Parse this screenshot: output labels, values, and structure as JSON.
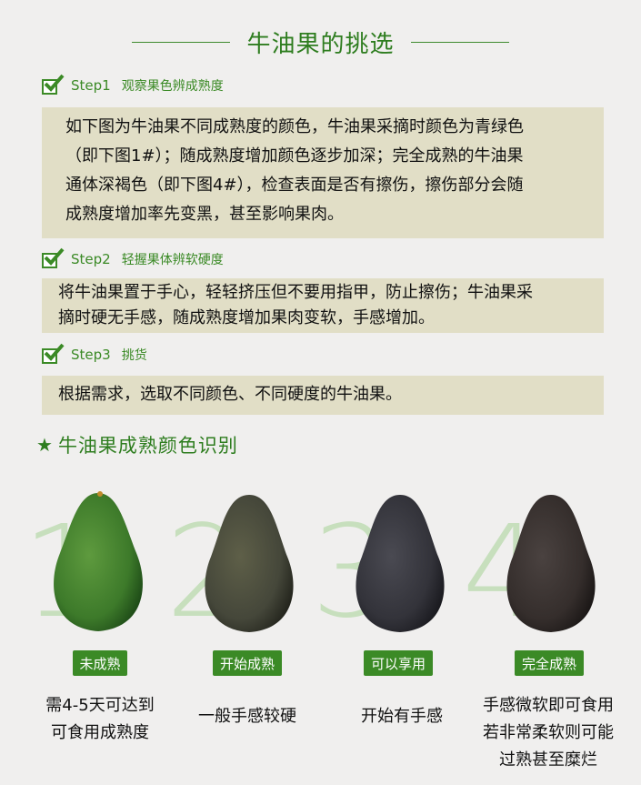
{
  "title": "牛油果的挑选",
  "steps": [
    {
      "num": "Step1",
      "title": "观察果色辨成熟度",
      "text": [
        "如下图为牛油果不同成熟度的颜色，牛油果采摘时颜色为青绿色",
        "（即下图1#）；随成熟度增加颜色逐步加深；完全成熟的牛油果",
        "通体深褐色（即下图4#），检查表面是否有擦伤，擦伤部分会随",
        "成熟度增加率先变黑，甚至影响果肉。"
      ]
    },
    {
      "num": "Step2",
      "title": "轻握果体辨软硬度",
      "text": [
        "将牛油果置于手心，轻轻挤压但不要用指甲，防止擦伤；牛油果采",
        "摘时硬无手感，随成熟度增加果肉变软，手感增加。"
      ]
    },
    {
      "num": "Step3",
      "title": "挑货",
      "text": [
        "根据需求，选取不同颜色、不同硬度的牛油果。"
      ]
    }
  ],
  "section2": {
    "title": "牛油果成熟颜色识别",
    "icon": "star-icon"
  },
  "stages": [
    {
      "number": "1",
      "label": "未成熟",
      "desc": [
        "需4-5天可达到",
        "可食用成熟度"
      ],
      "color": "#3e7a2c"
    },
    {
      "number": "2",
      "label": "开始成熟",
      "desc": [
        "一般手感较硬"
      ],
      "color": "#4a4c36"
    },
    {
      "number": "3",
      "label": "可以享用",
      "desc": [
        "开始有手感"
      ],
      "color": "#34343a"
    },
    {
      "number": "4",
      "label": "完全成熟",
      "desc": [
        "手感微软即可食用",
        "若非常柔软则可能",
        "过熟甚至糜烂"
      ],
      "color": "#3a3230"
    }
  ],
  "colors": {
    "accent": "#3b8a26",
    "box_bg": "#e1dec6",
    "page_bg": "#f0efee"
  }
}
